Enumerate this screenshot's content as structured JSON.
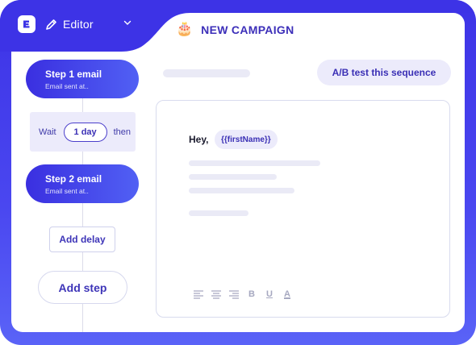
{
  "header": {
    "editor_label": "Editor",
    "campaign_emoji": "🎂",
    "campaign_title": "NEW CAMPAIGN"
  },
  "sequence": {
    "step1": {
      "title": "Step 1 email",
      "subtitle": "Email sent at.."
    },
    "wait": {
      "prefix": "Wait",
      "value": "1 day",
      "suffix": "then"
    },
    "step2": {
      "title": "Step 2 email",
      "subtitle": "Email sent at.."
    },
    "add_delay_label": "Add delay",
    "add_step_label": "Add step"
  },
  "main": {
    "ab_test_label": "A/B test this sequence",
    "email": {
      "greeting": "Hey,",
      "variable": "{{firstName}}"
    },
    "toolbar": [
      "align-left-icon",
      "align-center-icon",
      "align-right-icon",
      "bold-icon",
      "underline-icon",
      "text-color-icon"
    ],
    "toolbar_glyphs": {
      "bold": "B",
      "underline": "U",
      "text_color": "A"
    }
  },
  "colors": {
    "brand_blue": "#3d33e6",
    "step_gradient_start": "#3a2fe0",
    "step_gradient_end": "#5160f4",
    "accent_text": "#3a2fb5",
    "soft_fill": "#ecebfb"
  }
}
